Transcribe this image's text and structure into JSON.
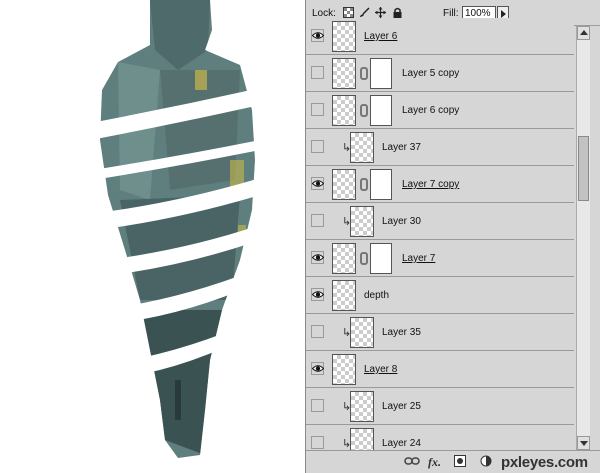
{
  "panel": {
    "lock_label": "Lock:",
    "fill_label": "Fill:",
    "fill_value": "100%"
  },
  "layers": [
    {
      "name": "Layer 6",
      "visible": true,
      "clipped": false,
      "mask": false,
      "underlined": true
    },
    {
      "name": "Layer 5 copy",
      "visible": false,
      "clipped": false,
      "mask": true,
      "underlined": false
    },
    {
      "name": "Layer 6 copy",
      "visible": false,
      "clipped": false,
      "mask": true,
      "underlined": false
    },
    {
      "name": "Layer 37",
      "visible": false,
      "clipped": true,
      "mask": false,
      "underlined": false
    },
    {
      "name": "Layer 7 copy",
      "visible": true,
      "clipped": false,
      "mask": true,
      "underlined": true
    },
    {
      "name": "Layer 30",
      "visible": false,
      "clipped": true,
      "mask": false,
      "underlined": false
    },
    {
      "name": "Layer 7",
      "visible": true,
      "clipped": false,
      "mask": true,
      "underlined": true
    },
    {
      "name": "depth",
      "visible": true,
      "clipped": false,
      "mask": false,
      "underlined": false
    },
    {
      "name": "Layer 35",
      "visible": false,
      "clipped": true,
      "mask": false,
      "underlined": false
    },
    {
      "name": "Layer 8",
      "visible": true,
      "clipped": false,
      "mask": false,
      "underlined": true
    },
    {
      "name": "Layer 25",
      "visible": false,
      "clipped": true,
      "mask": false,
      "underlined": false
    },
    {
      "name": "Layer 24",
      "visible": false,
      "clipped": true,
      "mask": false,
      "underlined": false
    }
  ],
  "bottom": {
    "fx_label": "fx.",
    "watermark": "pxleyes.com"
  },
  "icons": {
    "lock_transparency": "checker-lock-icon",
    "lock_paint": "brush-lock-icon",
    "lock_move": "move-lock-icon",
    "lock_all": "padlock-icon",
    "visibility": "eye-icon",
    "link": "chain-link-icon",
    "clip": "clip-arrow-icon"
  },
  "colors": {
    "panel_bg": "#d6d6d6",
    "statue": "#5f7f7e",
    "statue_dark": "#3b5253",
    "moss": "#c9b84a"
  }
}
